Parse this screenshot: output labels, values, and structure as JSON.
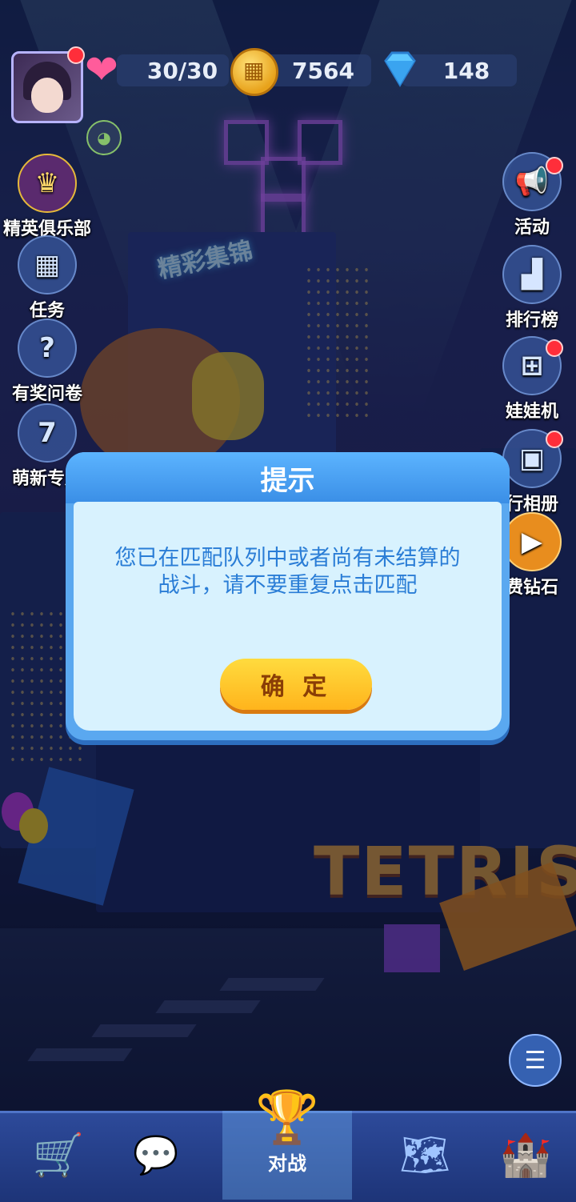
{
  "hud": {
    "lives": "30/30",
    "coins": "7564",
    "gems": "148"
  },
  "left_menu": [
    {
      "label": "精英俱乐部",
      "icon": "elite-badge-icon"
    },
    {
      "label": "任务",
      "icon": "calendar-icon"
    },
    {
      "label": "有奖问卷",
      "icon": "questionnaire-icon"
    },
    {
      "label": "萌新专属",
      "icon": "calendar-7-icon"
    }
  ],
  "right_menu": [
    {
      "label": "活动",
      "icon": "megaphone-icon"
    },
    {
      "label": "排行榜",
      "icon": "podium-icon"
    },
    {
      "label": "娃娃机",
      "icon": "claw-machine-icon"
    },
    {
      "label": "行相册",
      "icon": "album-icon"
    },
    {
      "label": "费钻石",
      "icon": "tv-play-icon"
    }
  ],
  "scene": {
    "billboard": "精彩集锦",
    "logo": "TETRIS"
  },
  "dialog": {
    "title": "提示",
    "message": "您已在匹配队列中或者尚有未结算的战斗，请不要重复点击匹配",
    "confirm_label": "确 定"
  },
  "bottom_nav": [
    {
      "label": "",
      "icon": "shop-cart-icon"
    },
    {
      "label": "",
      "icon": "chat-icon"
    },
    {
      "label": "对战",
      "icon": "trophy-icon"
    },
    {
      "label": "",
      "icon": "map-icon"
    },
    {
      "label": "",
      "icon": "castle-icon"
    }
  ]
}
